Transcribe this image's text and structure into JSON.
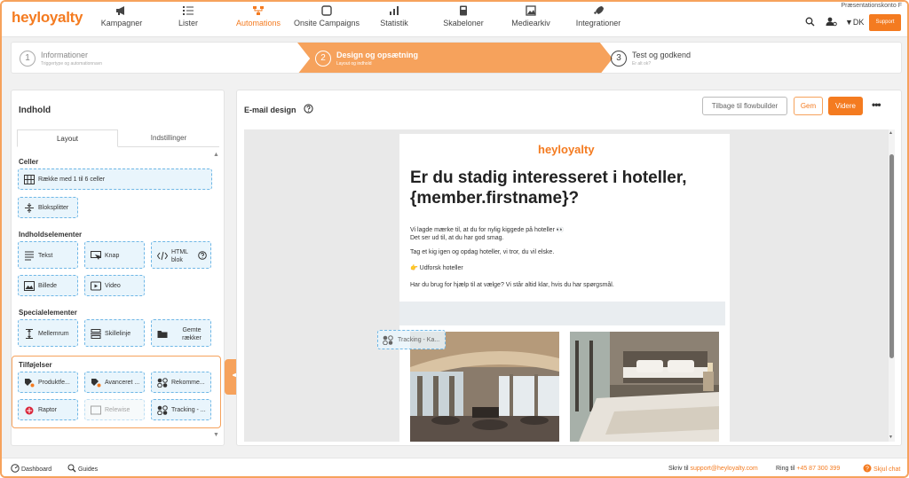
{
  "brand": {
    "logo": "heyloyalty",
    "accent": "#f47b20",
    "light_accent": "#f6a25c"
  },
  "nav": {
    "items": [
      {
        "label": "Kampagner",
        "icon": "megaphone-icon"
      },
      {
        "label": "Lister",
        "icon": "list-icon"
      },
      {
        "label": "Automations",
        "icon": "automation-icon",
        "active": true
      },
      {
        "label": "Onsite Campaigns",
        "icon": "onsite-icon"
      },
      {
        "label": "Statistik",
        "icon": "chart-icon"
      },
      {
        "label": "Skabeloner",
        "icon": "template-icon"
      },
      {
        "label": "Mediearkiv",
        "icon": "image-icon"
      },
      {
        "label": "Integrationer",
        "icon": "rocket-icon"
      }
    ],
    "account": "Præsentationskonto F",
    "language": "DK",
    "support": "Support"
  },
  "steps": [
    {
      "num": "1",
      "title": "Informationer",
      "subtitle": "Triggertype og automationnavn"
    },
    {
      "num": "2",
      "title": "Design og opsætning",
      "subtitle": "Layout og indhold"
    },
    {
      "num": "3",
      "title": "Test og godkend",
      "subtitle": "Er alt ok?"
    }
  ],
  "left": {
    "title": "Indhold",
    "tabs": [
      "Layout",
      "Indstillinger"
    ],
    "sections": {
      "cells": "Celler",
      "content": "Indholdselementer",
      "special": "Specialelementer",
      "addons": "Tilføjelser"
    },
    "tiles": {
      "row": "Række med 1 til 6 celler",
      "splitter": "Bloksplitter",
      "text": "Tekst",
      "button": "Knap",
      "html": "HTML blok",
      "image": "Billede",
      "video": "Video",
      "spacing": "Mellemrum",
      "divider": "Skillelinje",
      "saved": "Gemte rækker",
      "product": "Produktfe...",
      "advanced": "Avanceret ...",
      "recommend": "Rekomme...",
      "raptor": "Raptor",
      "relewise": "Relewise",
      "tracking": "Tracking - ..."
    }
  },
  "right": {
    "title": "E-mail design",
    "back_button": "Tilbage til flowbuilder",
    "save_button": "Gem",
    "next_button": "Videre",
    "email": {
      "logo": "heyloyalty",
      "heading": "Er du stadig interesseret i hoteller, {member.firstname}?",
      "p1a": "Vi lagde mærke til, at du for nylig kiggede på hoteller 👀",
      "p1b": "Det ser ud til, at du har god smag.",
      "p2": "Tag et kig igen og opdag hoteller, vi tror, du vil elske.",
      "p3": "👉 Udforsk hoteller",
      "p4": "Har du brug for hjælp til at vælge? Vi står altid klar, hvis du har spørgsmål."
    },
    "drag_tile": "Tracking - Ka..."
  },
  "footer": {
    "dashboard": "Dashboard",
    "guides": "Guides",
    "write_label": "Skriv til",
    "email": "support@heyloyalty.com",
    "call_label": "Ring til",
    "phone": "+45 87 300 399",
    "hide_chat": "Skjul chat"
  }
}
